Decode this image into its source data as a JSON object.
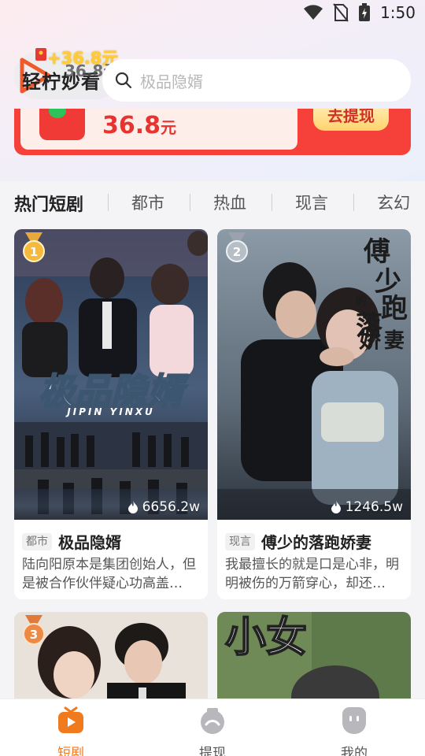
{
  "status_bar": {
    "time": "1:50"
  },
  "header": {
    "logo_text": "轻柠妙看",
    "floating_reward": "+36.8元",
    "floating_reward_ghost": "36.8元",
    "search_placeholder": "极品隐婿"
  },
  "banner": {
    "amount": "36.8",
    "unit": "元",
    "button_label": "去提现"
  },
  "tabs": [
    {
      "label": "热门短剧",
      "active": true
    },
    {
      "label": "都市",
      "active": false
    },
    {
      "label": "热血",
      "active": false
    },
    {
      "label": "现言",
      "active": false
    },
    {
      "label": "玄幻",
      "active": false
    }
  ],
  "cards": [
    {
      "rank": "1",
      "views": "6656.2w",
      "genre": "都市",
      "title": "极品隐婿",
      "description": "陆向阳原本是集团创始人，但是被合作伙伴疑心功高盖…",
      "poster_title": "极品隐婿",
      "poster_subtitle": "JIPIN YINXU"
    },
    {
      "rank": "2",
      "views": "1246.5w",
      "genre": "现言",
      "title": "傅少的落跑娇妻",
      "description": "我最擅长的就是口是心非，明明被伤的万箭穿心，却还…",
      "poster_title": "傅少的落跑娇妻"
    },
    {
      "rank": "3"
    },
    {
      "poster_title": "小女"
    }
  ],
  "bottom_nav": [
    {
      "label": "短剧",
      "icon": "drama-icon",
      "active": true
    },
    {
      "label": "提现",
      "icon": "withdraw-icon",
      "active": false
    },
    {
      "label": "我的",
      "icon": "profile-icon",
      "active": false
    }
  ],
  "colors": {
    "accent": "#f07a1e",
    "banner_red": "#f6403a",
    "reward_gold": "#ffcc33"
  }
}
